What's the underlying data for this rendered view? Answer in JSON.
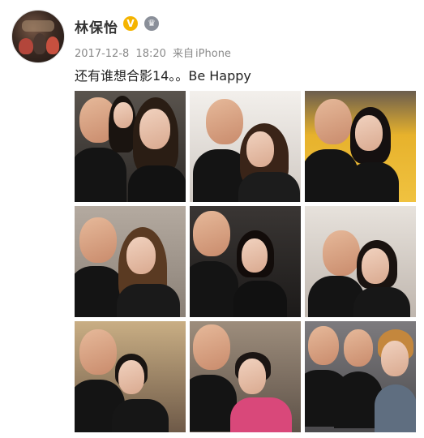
{
  "post": {
    "username": "林保怡",
    "verified_icon": "verified-v-icon",
    "member_icon": "crown-member-icon",
    "date": "2017-12-8",
    "time": "18:20",
    "source_prefix": "来自",
    "source": "iPhone",
    "text": "还有谁想合影14。。Be Happy"
  },
  "colors": {
    "verified_badge": "#f5b400",
    "username": "#333333",
    "meta": "#8a8a8a"
  },
  "photos": [
    {
      "label": "selfie-1",
      "bg": "#4a4540"
    },
    {
      "label": "selfie-2",
      "bg": "#ece8e4"
    },
    {
      "label": "selfie-3",
      "bg": "#e7b22c"
    },
    {
      "label": "selfie-4",
      "bg": "#a59a90"
    },
    {
      "label": "selfie-5",
      "bg": "#2e2b2a"
    },
    {
      "label": "selfie-6",
      "bg": "#d8d2cc"
    },
    {
      "label": "selfie-7",
      "bg": "#b89e78"
    },
    {
      "label": "selfie-8",
      "bg": "#8c7b6b"
    },
    {
      "label": "selfie-9",
      "bg": "#6f6d70"
    }
  ]
}
